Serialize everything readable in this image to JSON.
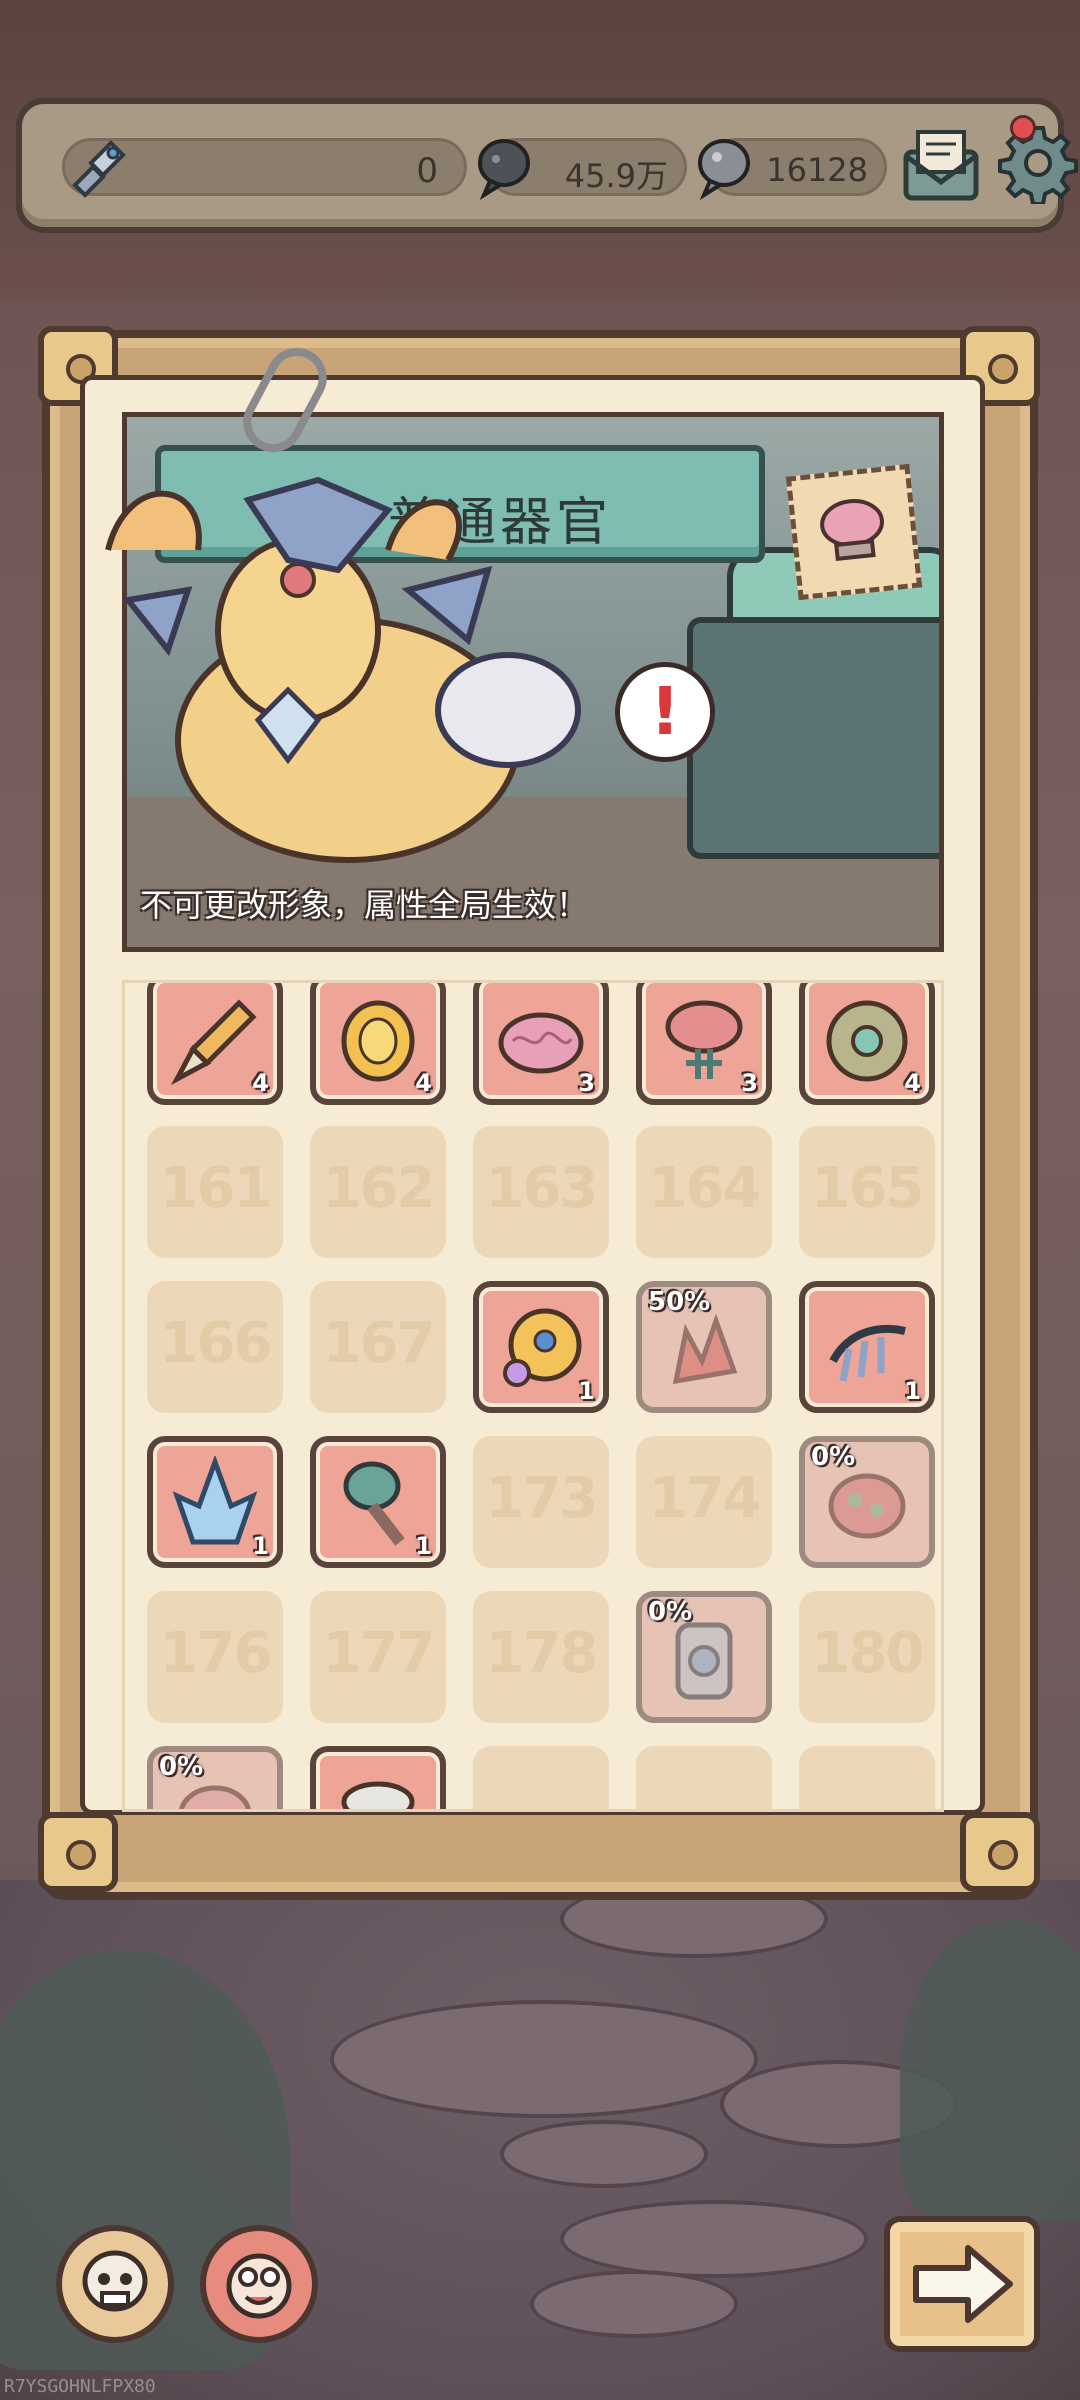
{
  "topbar": {
    "xp_value": "0",
    "currency1": "45.9万",
    "currency2": "16128"
  },
  "panel": {
    "title": "普通器官",
    "subtitle": "不可更改形象，属性全局生效！",
    "alert_mark": "!"
  },
  "grid": {
    "row1": [
      {
        "count": "4",
        "icon": "dagger-icon"
      },
      {
        "count": "4",
        "icon": "gold-coin-icon"
      },
      {
        "count": "3",
        "icon": "brain-icon"
      },
      {
        "count": "3",
        "icon": "organ-tree-icon"
      },
      {
        "count": "4",
        "icon": "round-shield-icon"
      }
    ],
    "row2": [
      "161",
      "162",
      "163",
      "164",
      "165"
    ],
    "row3_empty": [
      "166",
      "167"
    ],
    "row3_items": [
      {
        "count": "1",
        "icon": "eye-medallion-icon"
      },
      {
        "percent": "50%",
        "icon": "red-coral-icon"
      },
      {
        "count": "1",
        "icon": "claw-icon"
      }
    ],
    "row4_items": [
      {
        "count": "1",
        "icon": "ice-crystal-icon"
      },
      {
        "count": "1",
        "icon": "mushroom-stalk-icon"
      }
    ],
    "row4_empty": [
      "173",
      "174"
    ],
    "row4_partial": {
      "percent": "0%",
      "icon": "flower-brain-icon"
    },
    "row5_empty": [
      "176",
      "177",
      "178",
      "180"
    ],
    "row5_partial": {
      "percent": "0%",
      "icon": "jar-icon"
    },
    "row6_partial": {
      "percent": "0%"
    }
  },
  "watermark": "R7YSGOHNLFPX80",
  "colors": {
    "slot_filled": "#eea497",
    "slot_empty": "#ecd8b8",
    "frame": "#c9a479",
    "ribbon": "#7fbdb3"
  }
}
